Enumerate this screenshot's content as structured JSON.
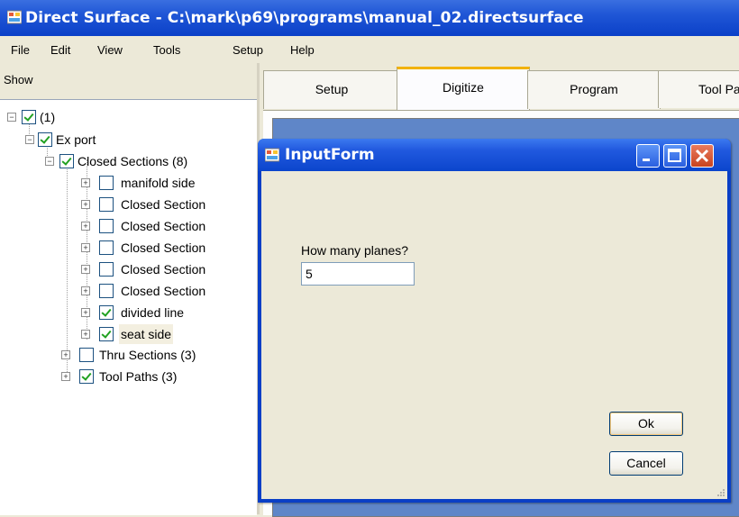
{
  "window": {
    "title": "Direct Surface - C:\\mark\\p69\\programs\\manual_02.directsurface",
    "icon": "app-icon"
  },
  "menu": [
    "File",
    "Edit",
    "View",
    "Tools",
    "Setup",
    "Help"
  ],
  "show_label": "Show",
  "tree": {
    "root": "(1)",
    "export": "Ex port",
    "closed_sections": "Closed Sections (8)",
    "items": [
      "manifold side",
      "Closed Section",
      "Closed Section",
      "Closed Section",
      "Closed Section",
      "Closed Section",
      "divided line",
      "seat side"
    ],
    "thru_sections": "Thru Sections (3)",
    "tool_paths": "Tool Paths (3)"
  },
  "tabs": [
    "Setup",
    "Digitize",
    "Program",
    "Tool Pa"
  ],
  "active_tab": "Digitize",
  "dialog": {
    "title": "InputForm",
    "label": "How many planes?",
    "value": "5",
    "ok": "Ok",
    "cancel": "Cancel"
  },
  "colors": {
    "titlebar": "#0b40c8",
    "viewport": "#5f86c8",
    "active_tab_accent": "#f2b200"
  }
}
